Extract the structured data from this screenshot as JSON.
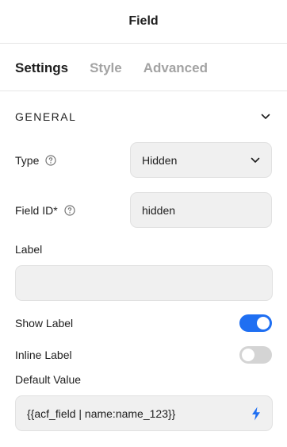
{
  "header": {
    "title": "Field"
  },
  "tabs": [
    {
      "label": "Settings",
      "active": true
    },
    {
      "label": "Style",
      "active": false
    },
    {
      "label": "Advanced",
      "active": false
    }
  ],
  "general": {
    "title": "GENERAL",
    "type": {
      "label": "Type",
      "value": "Hidden"
    },
    "field_id": {
      "label": "Field ID*",
      "value": "hidden"
    },
    "label_field": {
      "label": "Label",
      "value": ""
    },
    "show_label": {
      "label": "Show Label",
      "on": true
    },
    "inline_label": {
      "label": "Inline Label",
      "on": false
    },
    "default_value": {
      "label": "Default Value",
      "value": "{{acf_field | name:name_123}}"
    }
  },
  "colors": {
    "accent": "#1f6ff2",
    "toggle_off": "#d4d4d4",
    "field_bg": "#f0f0f0"
  },
  "icons": {
    "help": "question-circle-icon",
    "chevron": "chevron-down-icon",
    "dynamic": "lightning-bolt-icon"
  }
}
